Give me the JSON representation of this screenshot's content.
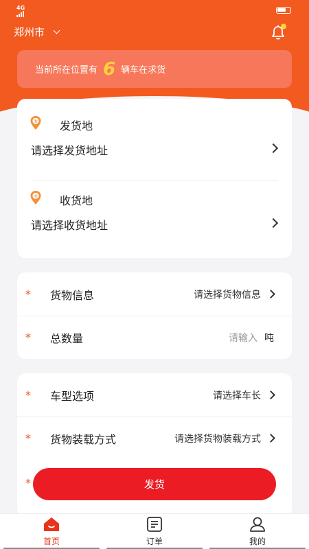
{
  "status_bar": {
    "network": "4G"
  },
  "header": {
    "city": "郑州市"
  },
  "banner": {
    "prefix": "当前所在位置有",
    "count": "6",
    "suffix": "辆车在求货"
  },
  "shipping": {
    "origin_title": "发货地",
    "origin_placeholder": "请选择发货地址",
    "origin_pin_text": "发",
    "destination_title": "收货地",
    "destination_placeholder": "请选择收货地址",
    "destination_pin_text": "收"
  },
  "cargo": {
    "required_mark": "*",
    "info_label": "货物信息",
    "info_value": "请选择货物信息",
    "quantity_label": "总数量",
    "quantity_placeholder": "请输入",
    "quantity_unit": "吨"
  },
  "vehicle": {
    "type_label": "车型选项",
    "type_value": "请选择车长",
    "loading_label": "货物装载方式",
    "loading_value": "请选择货物装载方式"
  },
  "submit_label": "发货",
  "tabs": [
    {
      "label": "首页",
      "icon": "home-icon",
      "active": true
    },
    {
      "label": "订单",
      "icon": "order-icon",
      "active": false
    },
    {
      "label": "我的",
      "icon": "user-icon",
      "active": false
    }
  ],
  "colors": {
    "brand": "#f25a1f",
    "banner": "#f7775a",
    "highlight": "#ffd23f",
    "button": "#ec1c24"
  }
}
